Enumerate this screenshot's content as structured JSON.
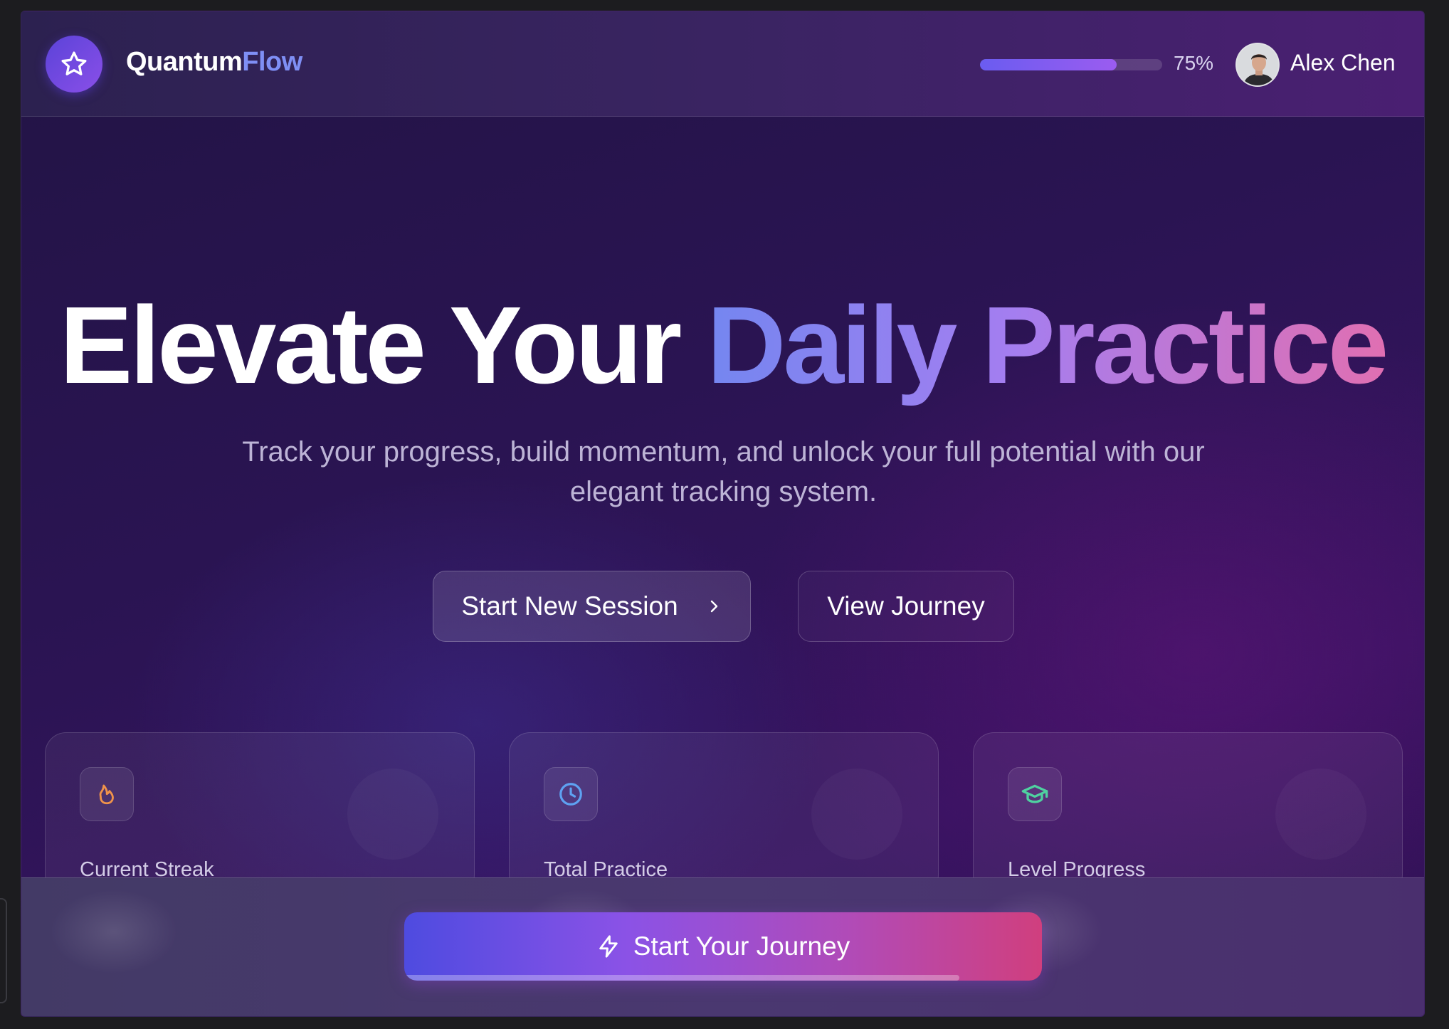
{
  "header": {
    "brand_main": "Quantum",
    "brand_accent": "Flow",
    "logo_icon": "star-icon",
    "progress_percent": 75,
    "progress_label": "75%",
    "user_name": "Alex Chen"
  },
  "hero": {
    "title_plain": "Elevate Your",
    "title_gradient": "Daily Practice",
    "subtitle": "Track your progress, build momentum, and unlock your full potential with our elegant tracking system.",
    "primary_button": "Start New Session",
    "secondary_button": "View Journey"
  },
  "stats": [
    {
      "label": "Current Streak",
      "icon": "flame-icon",
      "color": "#f0934a"
    },
    {
      "label": "Total Practice",
      "icon": "clock-icon",
      "color": "#5ea2f2"
    },
    {
      "label": "Level Progress",
      "icon": "graduation-cap-icon",
      "color": "#4fd1a0"
    }
  ],
  "footer": {
    "cta_label": "Start Your Journey",
    "cta_icon": "lightning-icon",
    "cta_progress_fraction": 0.87
  },
  "colors": {
    "brand_accent": "#7f8ff5",
    "cta_start": "#4e4be0",
    "cta_end": "#d03f7e"
  }
}
